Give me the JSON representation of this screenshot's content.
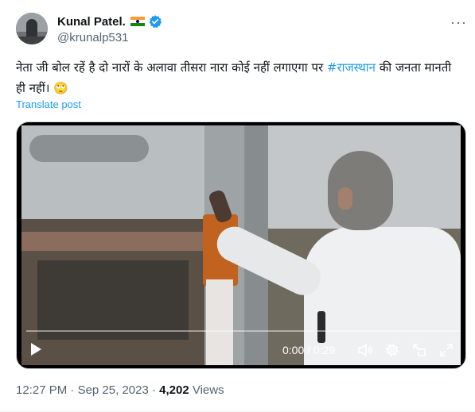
{
  "author": {
    "display_name": "Kunal Patel.",
    "flag_emoji": "🇮🇳",
    "handle": "@krunalp531",
    "verified": true,
    "verified_color": "#1d9bf0"
  },
  "post": {
    "text_main": "नेता जी बोल रहें है दो नारों के अलावा तीसरा नारा कोई नहीं लगाएगा पर ",
    "hashtag": "#राजस्थान",
    "text_tail": " की जनता मानती ही नहीं। ",
    "emoji": "🙄",
    "translate_label": "Translate post"
  },
  "video": {
    "time_display": "0:00 / 0:29",
    "progress": 0,
    "icons": [
      "play-icon",
      "volume-icon",
      "settings-icon",
      "pop-out-icon",
      "fullscreen-icon"
    ]
  },
  "meta": {
    "time": "12:27 PM",
    "separator": " · ",
    "date": "Sep 25, 2023",
    "views_count": "4,202",
    "views_label": " Views"
  },
  "more_menu": "···",
  "colors": {
    "accent": "#1d9bf0",
    "text": "#0f1419",
    "secondary": "#536471"
  }
}
